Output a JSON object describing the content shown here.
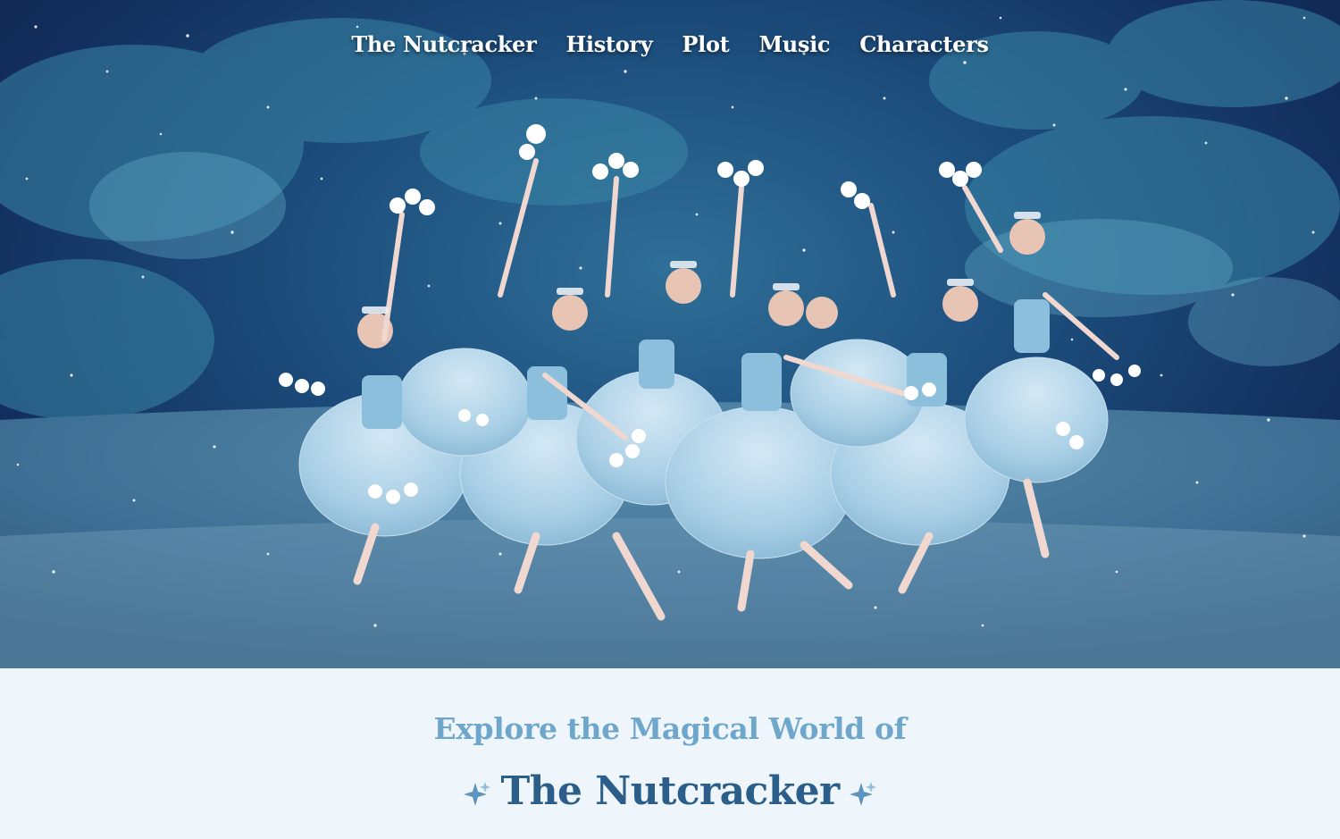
{
  "nav": {
    "items": [
      {
        "label": "The Nutcracker"
      },
      {
        "label": "History"
      },
      {
        "label": "Plot"
      },
      {
        "label": "Music"
      },
      {
        "label": "Characters"
      }
    ]
  },
  "hero": {
    "image_subject": "Snowflake ballet dancers in blue tutus on a snowy stage",
    "colors": {
      "backdrop": "#1c4d7c",
      "tutu": "#a9cfe6",
      "snow": "#ffffff"
    }
  },
  "intro": {
    "eyebrow": "Explore the Magical World of",
    "title": "The Nutcracker",
    "sparkle_icon": "sparkle-icon",
    "colors": {
      "eyebrow": "#6fa6cc",
      "title": "#2b5f8a",
      "background": "#eef6fb"
    }
  }
}
